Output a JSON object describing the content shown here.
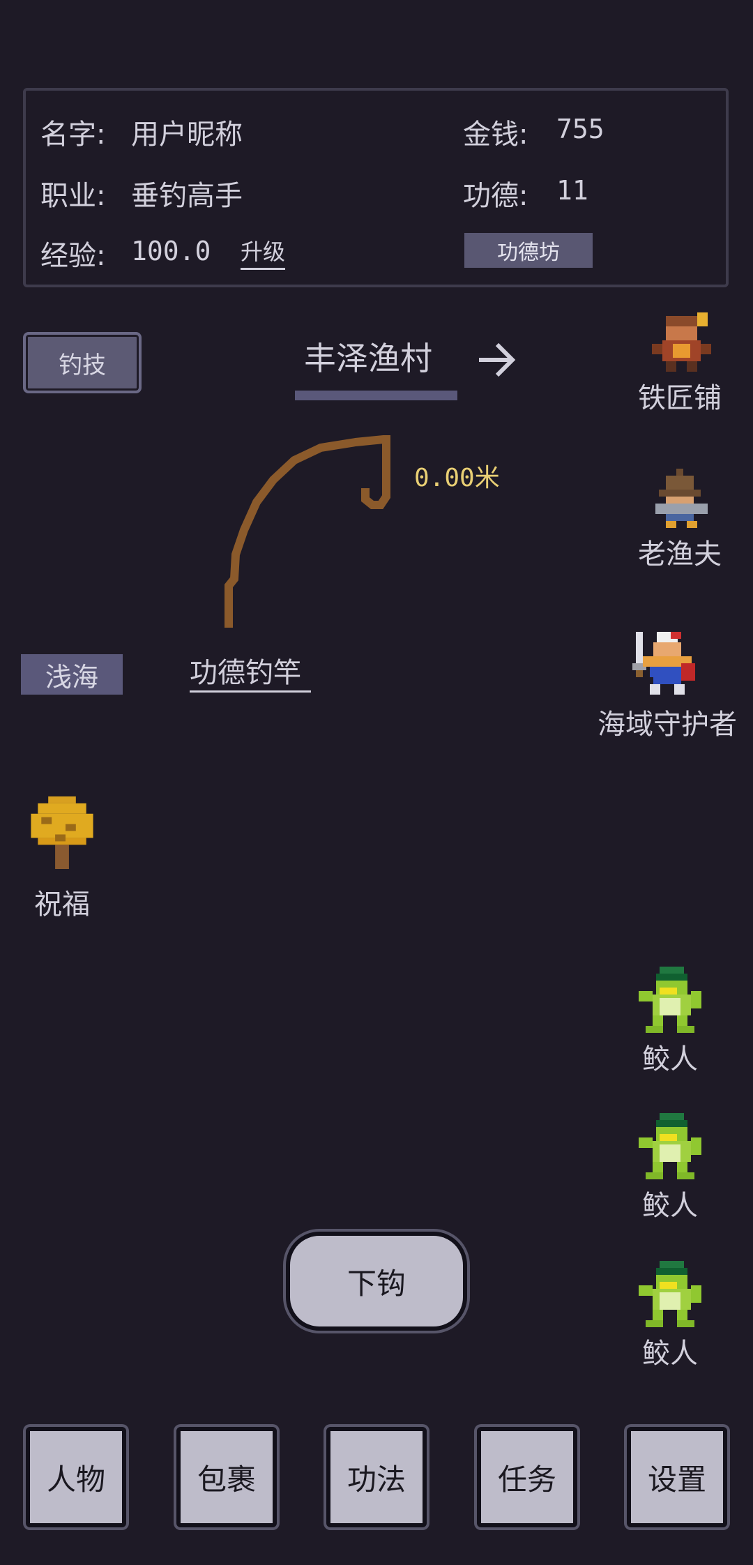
{
  "player": {
    "name_label": "名字:",
    "name_value": "用户昵称",
    "job_label": "职业:",
    "job_value": "垂钓高手",
    "exp_label": "经验:",
    "exp_value": "100.0",
    "levelup_label": "升级",
    "money_label": "金钱:",
    "money_value": "755",
    "merit_label": "功德:",
    "merit_value": "11",
    "merit_shop_label": "功德坊"
  },
  "skill_button": "钓技",
  "location": {
    "name": "丰泽渔村",
    "arrow_icon": "arrow-right-icon"
  },
  "fishing": {
    "distance": "0.00米",
    "zone": "浅海",
    "rod_name": "功德钓竿"
  },
  "blessing": {
    "label": "祝福",
    "icon": "golden-tree-icon"
  },
  "npcs": [
    {
      "label": "铁匠铺",
      "icon": "blacksmith-icon"
    },
    {
      "label": "老渔夫",
      "icon": "old-fisherman-icon"
    },
    {
      "label": "海域守护者",
      "icon": "sea-guardian-icon"
    }
  ],
  "monsters": [
    {
      "label": "鲛人",
      "icon": "merfolk-icon"
    },
    {
      "label": "鲛人",
      "icon": "merfolk-icon"
    },
    {
      "label": "鲛人",
      "icon": "merfolk-icon"
    }
  ],
  "cast_button": "下钩",
  "nav": [
    "人物",
    "包裹",
    "功法",
    "任务",
    "设置"
  ],
  "colors": {
    "background": "#1e1a26",
    "text": "#d2d0dc",
    "accent_bar": "#5a587a",
    "distance": "#e9cf74",
    "rod": "#8b5a2b",
    "button_face": "#bebcca"
  }
}
